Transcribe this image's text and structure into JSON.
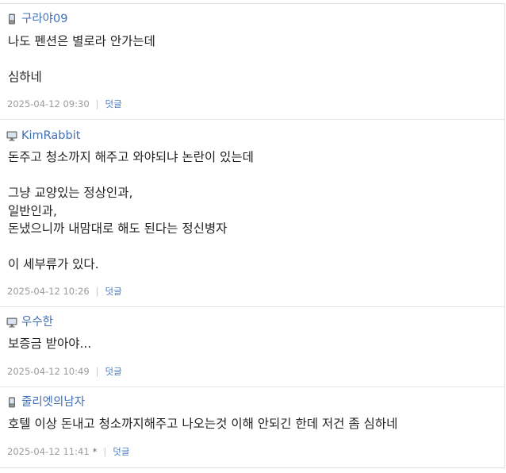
{
  "comments": [
    {
      "author": "구라야09",
      "device": "mobile-icon",
      "lines": [
        "나도 펜션은 별로라 안가는데",
        "",
        "심하네"
      ],
      "time": "2025-04-12 09:30",
      "reply_label": "덧글"
    },
    {
      "author": "KimRabbit",
      "device": "monitor-icon",
      "lines": [
        "돈주고 청소까지 해주고 와야되냐 논란이 있는데",
        "",
        "그냥 교양있는 정상인과,",
        "일반인과,",
        "돈냈으니까 내맘대로 해도 된다는 정신병자",
        "",
        "이 세부류가 있다."
      ],
      "time": "2025-04-12 10:26",
      "reply_label": "덧글"
    },
    {
      "author": "우수한",
      "device": "monitor-icon",
      "lines": [
        "보증금 받아야..."
      ],
      "time": "2025-04-12 10:49",
      "reply_label": "덧글"
    },
    {
      "author": "줄리엣의남자",
      "device": "mobile-icon",
      "lines": [
        "호텔 이상 돈내고 청소까지해주고 나오는것 이해 안되긴 한데 저건 좀 심하네"
      ],
      "time": "2025-04-12 11:41",
      "edited_mark": "*",
      "reply_label": "덧글"
    }
  ],
  "separator": "|",
  "colors": {
    "author": "#3f6fb7",
    "reply": "#4a7cc7",
    "meta": "#9a9a9a",
    "text": "#222222"
  }
}
